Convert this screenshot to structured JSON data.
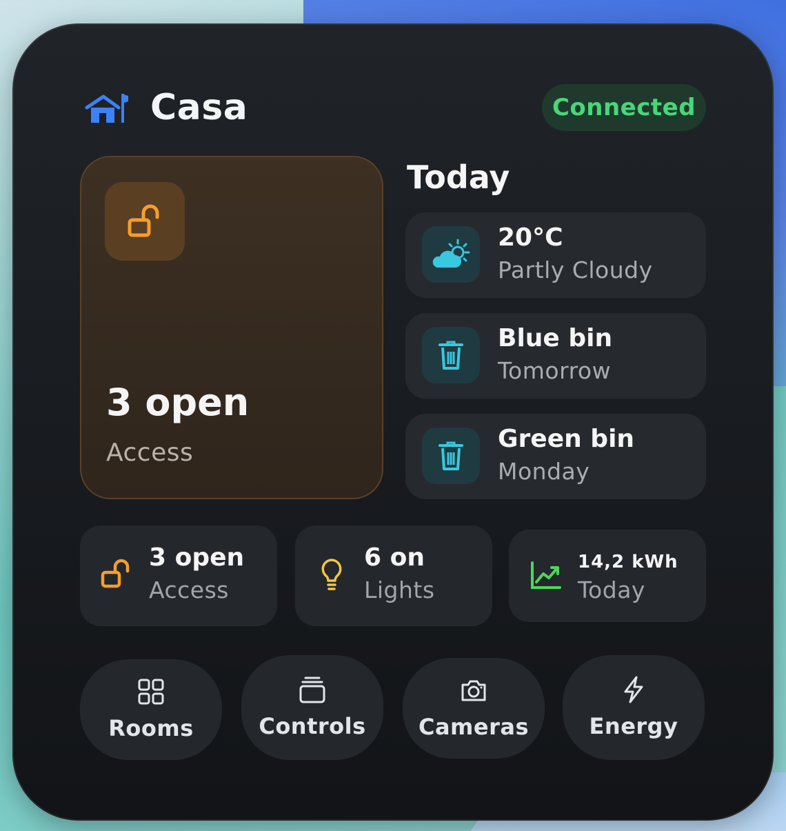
{
  "header": {
    "title": "Casa",
    "status": "Connected",
    "icon": "house-flag-icon"
  },
  "access_card": {
    "value": "3 open",
    "label": "Access",
    "icon": "unlocked-padlock-icon"
  },
  "today": {
    "title": "Today",
    "items": [
      {
        "title": "20°C",
        "subtitle": "Partly Cloudy",
        "icon": "partly-cloudy-icon"
      },
      {
        "title": "Blue bin",
        "subtitle": "Tomorrow",
        "icon": "trash-bin-icon"
      },
      {
        "title": "Green bin",
        "subtitle": "Monday",
        "icon": "trash-bin-icon"
      }
    ]
  },
  "stats": [
    {
      "value": "3 open",
      "label": "Access",
      "icon": "unlocked-padlock-icon"
    },
    {
      "value": "6 on",
      "label": "Lights",
      "icon": "lightbulb-icon"
    },
    {
      "value": "14,2 kWh",
      "label": "Today",
      "icon": "chart-trend-icon"
    }
  ],
  "nav": [
    {
      "label": "Rooms",
      "icon": "grid-icon"
    },
    {
      "label": "Controls",
      "icon": "stack-icon"
    },
    {
      "label": "Cameras",
      "icon": "camera-icon"
    },
    {
      "label": "Energy",
      "icon": "lightning-bolt-icon"
    }
  ],
  "colors": {
    "accent_blue": "#3b82f6",
    "connected_green": "#47d77a",
    "access_orange": "#f59e2e",
    "weather_cyan": "#38c8e0",
    "energy_green": "#4fd65a",
    "light_yellow": "#f5c542"
  }
}
